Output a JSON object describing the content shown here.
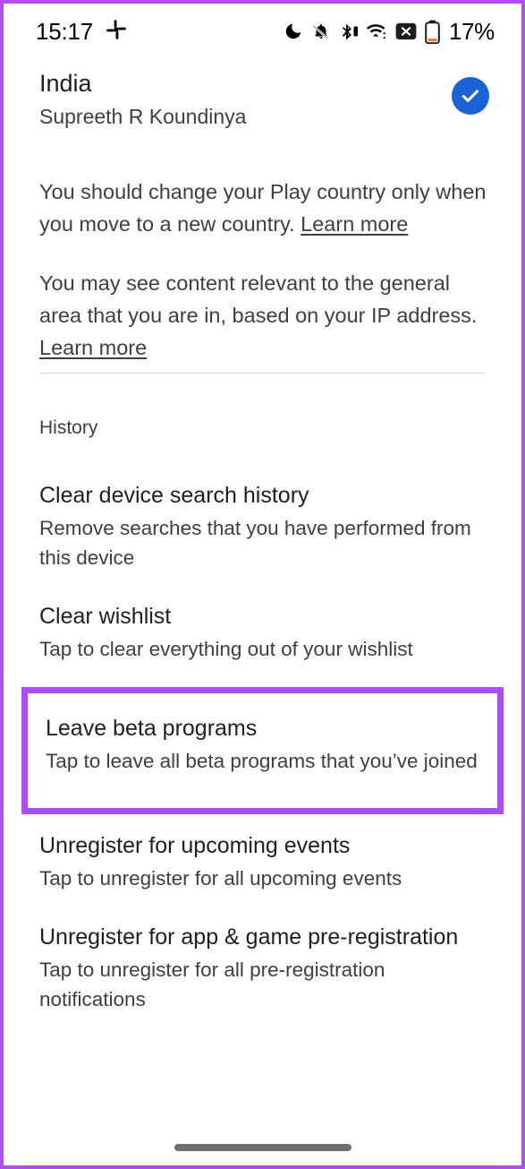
{
  "status_bar": {
    "time": "15:17",
    "app_icon": "slack-icon",
    "icons": [
      "do-not-disturb-moon-icon",
      "notifications-muted-bell-icon",
      "bluetooth-icon",
      "wifi-icon",
      "no-sim-x-icon",
      "battery-icon"
    ],
    "battery_percent": "17%"
  },
  "country": {
    "name": "India",
    "account": "Supreeth R Koundinya",
    "selected_icon": "check-circle-icon"
  },
  "info": {
    "paragraph_1_text": "You should change your Play country only when you move to a new country. ",
    "paragraph_1_link": "Learn more",
    "paragraph_2_text": "You may see content relevant to the general area that you are in, based on your IP address. ",
    "paragraph_2_link": "Learn more"
  },
  "history": {
    "section_label": "History",
    "items": [
      {
        "title": "Clear device search history",
        "subtitle": "Remove searches that you have performed from this device"
      },
      {
        "title": "Clear wishlist",
        "subtitle": "Tap to clear everything out of your wishlist"
      },
      {
        "title": "Leave beta programs",
        "subtitle": "Tap to leave all beta programs that you’ve joined"
      },
      {
        "title": "Unregister for upcoming events",
        "subtitle": "Tap to unregister for all upcoming events"
      },
      {
        "title": "Unregister for app & game pre-registration",
        "subtitle": "Tap to unregister for all pre-registration notifications"
      }
    ]
  },
  "colors": {
    "highlight_purple": "#ab4ef2",
    "check_blue": "#1a62d6",
    "battery_low_orange": "#e8833a"
  }
}
